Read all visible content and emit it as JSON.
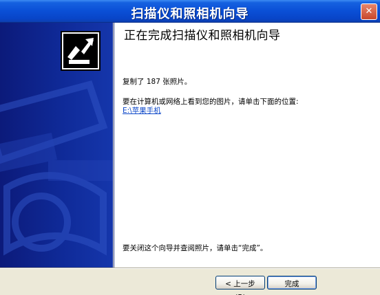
{
  "window": {
    "title": "扫描仪和照相机向导",
    "close_glyph": "✕"
  },
  "content": {
    "heading": "正在完成扫描仪和照相机向导",
    "copied_message": "复制了 187 张照片。",
    "view_prompt": "要在计算机或网络上看到您的图片，请单击下面的位置:",
    "location_link": "E:\\苹果手机",
    "finish_prompt": "要关闭这个向导并查阅照片，请单击“完成”。"
  },
  "buttons": {
    "back_label": "< 上一步(B)",
    "finish_label": "完成"
  },
  "icons": {
    "wizard": "scanner-camera-wizard-icon",
    "title": "window-icon"
  },
  "colors": {
    "title_bar": "#0a4fd6",
    "sidebar": "#0f2a98",
    "link": "#0b46c8"
  }
}
